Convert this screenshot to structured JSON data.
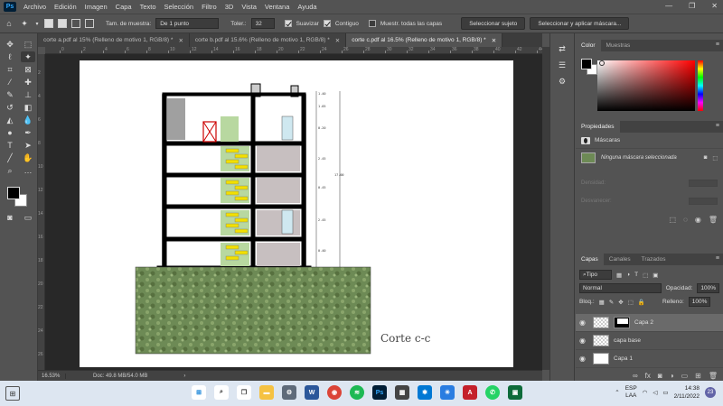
{
  "app": {
    "logo": "Ps"
  },
  "menu": [
    "Archivo",
    "Edición",
    "Imagen",
    "Capa",
    "Texto",
    "Selección",
    "Filtro",
    "3D",
    "Vista",
    "Ventana",
    "Ayuda"
  ],
  "window_controls": {
    "minimize": "—",
    "restore": "❐",
    "close": "✕"
  },
  "options": {
    "sample_size_label": "Tam. de muestra:",
    "sample_size_value": "De 1 punto",
    "tolerance_label": "Toler.:",
    "tolerance_value": "32",
    "antialias_label": "Suavizar",
    "contiguous_label": "Contiguo",
    "sample_all_label": "Muestr. todas las capas",
    "select_subject": "Seleccionar sujeto",
    "select_mask": "Seleccionar y aplicar máscara..."
  },
  "tabs": [
    {
      "label": "corte a.pdf al 15% (Relleno de motivo 1, RGB/8) *"
    },
    {
      "label": "corte b.pdf al 15.6% (Relleno de motivo 1, RGB/8) *"
    },
    {
      "label": "corte c.pdf al 16.5% (Relleno de motivo 1, RGB/8) *"
    }
  ],
  "ruler_h": [
    "0",
    "2",
    "4",
    "6",
    "8",
    "10",
    "12",
    "14",
    "16",
    "18",
    "20",
    "22",
    "24",
    "26",
    "28",
    "30",
    "32",
    "34",
    "36",
    "38",
    "40",
    "42",
    "44"
  ],
  "ruler_v": [
    "2",
    "4",
    "6",
    "8",
    "10",
    "12",
    "14",
    "16",
    "18",
    "20",
    "22",
    "24",
    "26"
  ],
  "drawing": {
    "title": "Corte c-c",
    "dims": [
      "1.40",
      "1.05",
      "0.20",
      "2.45",
      "0.45",
      "2.45",
      "0.20",
      "2.45",
      "0.20",
      "2.45",
      "0.40"
    ],
    "total": "17.00"
  },
  "status": {
    "zoom": "16.53%",
    "doc": "Doc: 49.8 MB/54.0 MB",
    "arrow": "›"
  },
  "color_panel": {
    "tabs": [
      "Color",
      "Muestras"
    ],
    "fg": "#000000",
    "bg": "#ffffff"
  },
  "properties": {
    "title": "Propiedades",
    "section": "Máscaras",
    "no_mask": "Ninguna máscara seleccionada",
    "density": "Densidad:",
    "feather": "Desvanecer:"
  },
  "layers_panel": {
    "tabs": [
      "Capas",
      "Canales",
      "Trazados"
    ],
    "filter": "Tipo",
    "blend": "Normal",
    "opacity_label": "Opacidad:",
    "opacity_value": "100%",
    "lock_label": "Bloq.:",
    "fill_label": "Relleno:",
    "fill_value": "100%",
    "layers": [
      {
        "name": "Capa 2",
        "selected": true
      },
      {
        "name": "capa base",
        "selected": false
      },
      {
        "name": "Capa 1",
        "selected": false
      }
    ]
  },
  "taskbar": {
    "lang": "ESP",
    "region": "LAA",
    "time": "14:38",
    "date": "2/11/2022",
    "badge": "23"
  },
  "colors": {
    "accent": "#31a8ff",
    "grass": "#6d8a55",
    "chrome": "#535353"
  }
}
